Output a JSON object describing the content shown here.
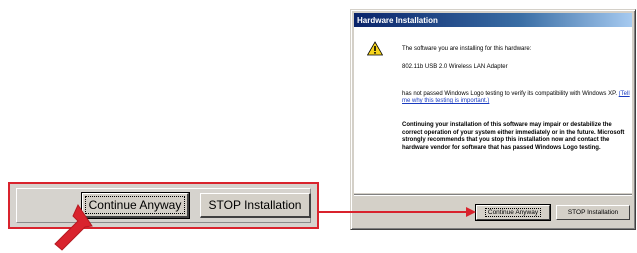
{
  "zoom": {
    "continue_label": "Continue Anyway",
    "stop_label": "STOP Installation"
  },
  "dialog": {
    "title": "Hardware Installation",
    "intro": "The software you are installing for this hardware:",
    "device": "802.11b USB 2.0 Wireless LAN Adapter",
    "logo_text": "has not passed Windows Logo testing to verify its compatibility with Windows XP.",
    "logo_link": "(Tell me why this testing is important.)",
    "warning": "Continuing your installation of this software may impair or destabilize the correct operation of your system either immediately or in the future. Microsoft strongly recommends that you stop this installation now and contact the hardware vendor for software that has passed Windows Logo testing.",
    "continue_label": "Continue Anyway",
    "stop_label": "STOP Installation"
  },
  "colors": {
    "highlight": "#d9232d",
    "titlebar": "#0a246a",
    "face": "#d4d0c8"
  },
  "icons": {
    "warning": "warning-icon",
    "pointer_arrow": "pointer-arrow-icon"
  }
}
